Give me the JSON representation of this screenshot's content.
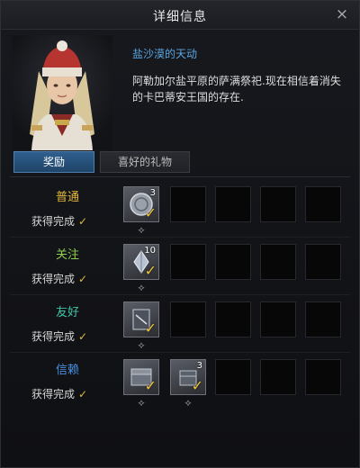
{
  "window": {
    "title": "详细信息",
    "close_icon": "×"
  },
  "npc": {
    "name": "盐沙漠的天动",
    "description": "阿勒加尔盐平原的萨满祭祀.现在相信着消失的卡巴蒂安王国的存在."
  },
  "tabs": [
    {
      "label": "奖励",
      "active": true
    },
    {
      "label": "喜好的礼物",
      "active": false
    }
  ],
  "colors": {
    "tier_normal": "#e3b93a",
    "tier_attention": "#8dcf4e",
    "tier_friendly": "#3fc6a8",
    "tier_trust": "#4a8fe0",
    "check": "#f0c33c",
    "accent_blue": "#5aa6e0"
  },
  "tiers": [
    {
      "name": "普通",
      "status": "获得完成",
      "rewards": [
        {
          "icon": "coin-disc-icon",
          "count": "3",
          "claimed": true
        }
      ]
    },
    {
      "name": "关注",
      "status": "获得完成",
      "rewards": [
        {
          "icon": "crystal-shard-icon",
          "count": "10",
          "claimed": true
        }
      ]
    },
    {
      "name": "友好",
      "status": "获得完成",
      "rewards": [
        {
          "icon": "scroll-card-icon",
          "count": "",
          "claimed": true
        }
      ]
    },
    {
      "name": "信赖",
      "status": "获得完成",
      "rewards": [
        {
          "icon": "chest-icon",
          "count": "",
          "claimed": true
        },
        {
          "icon": "box-icon",
          "count": "3",
          "claimed": true
        }
      ]
    }
  ],
  "slots_per_tier": 5,
  "glyphs": {
    "check": "✓",
    "marker": "⟡"
  }
}
